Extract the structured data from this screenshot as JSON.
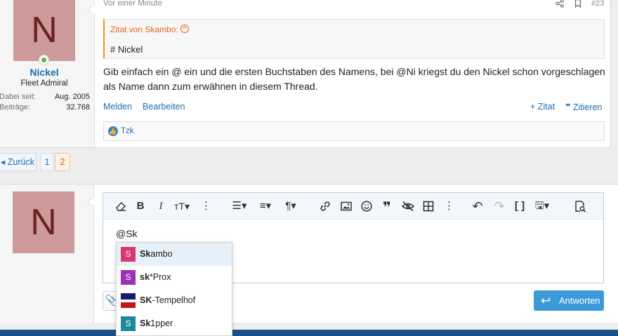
{
  "post": {
    "author": {
      "avatar_letter": "N",
      "name": "Nickel",
      "title": "Fleet Admiral",
      "stats": [
        {
          "label": "Dabei seit:",
          "value": "Aug. 2005"
        },
        {
          "label": "Beiträge:",
          "value": "32.768"
        }
      ]
    },
    "time": "Vor einer Minute",
    "number": "#23",
    "quote": {
      "header": "Zitat von Skambo:",
      "text": "# Nickel"
    },
    "message": "Gib einfach ein @ ein und die ersten Buchstaben des Namens, bei @Ni kriegst du den Nickel schon vorgeschlagen als Name dann zum erwähnen in diesem Thread.",
    "actions": {
      "report": "Melden",
      "edit": "Bearbeiten",
      "quote_plus": "+ Zitat",
      "quote": "Zitieren"
    },
    "reaction_user": "Tzk"
  },
  "pagination": {
    "back": "Zurück",
    "pages": [
      "1",
      "2"
    ]
  },
  "reply": {
    "avatar_letter": "N",
    "editor_text": "@Sk",
    "submit": "Antworten"
  },
  "mentions": [
    {
      "match": "Sk",
      "rest": "ambo",
      "avatar": "S",
      "color": "#d9376f",
      "active": true
    },
    {
      "match": "sk",
      "rest": "*Prox",
      "avatar": "S",
      "color": "#9b33b4",
      "active": false
    },
    {
      "match": "SK",
      "rest": "-Tempelhof",
      "avatar": "",
      "color": "#c21717",
      "active": false
    },
    {
      "match": "Sk",
      "rest": "1pper",
      "avatar": "S",
      "color": "#1b8a9d",
      "active": false
    }
  ],
  "colors": {
    "link": "#1e6fab",
    "accent_orange": "#e3651a",
    "button_blue": "#3d9ad8",
    "footer": "#1c4f85"
  },
  "icons": {
    "toolbar": [
      "eraser-icon",
      "bold-icon",
      "italic-icon",
      "text-size-icon",
      "more-icon",
      "list-icon",
      "align-icon",
      "paragraph-icon",
      "link-icon",
      "image-icon",
      "emoji-icon",
      "quote-icon",
      "hide-icon",
      "table-icon",
      "more-icon",
      "undo-icon",
      "redo-icon",
      "bbcode-icon",
      "save-draft-icon",
      "preview-icon"
    ]
  }
}
